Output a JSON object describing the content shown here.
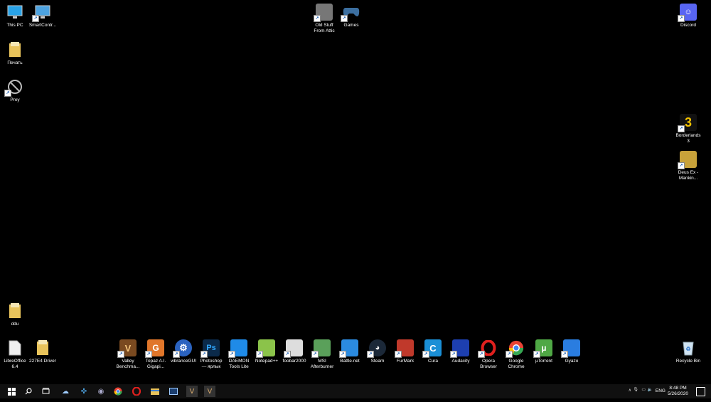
{
  "desktop": {
    "icons": [
      {
        "label": "This PC",
        "icon": "monitor-icon",
        "color": "#29a3e8"
      },
      {
        "label": "SmartContr...",
        "icon": "smartcontrol-icon",
        "color": "#4da3e0"
      },
      {
        "label": "Печать",
        "icon": "folder-icon",
        "color": "#e8c35b"
      },
      {
        "label": "Prey",
        "icon": "prey-icon",
        "color": "#cccccc"
      },
      {
        "label": "Old Stuff\nFrom Attic",
        "icon": "folder-people-icon",
        "color": "#777777"
      },
      {
        "label": "Games",
        "icon": "gamepad-icon",
        "color": "#3c6fa0"
      },
      {
        "label": "Discord",
        "icon": "discord-icon",
        "color": "#5865f2"
      },
      {
        "label": "Borderlands 3",
        "icon": "borderlands-icon",
        "color": "#f2c200"
      },
      {
        "label": "Deus Ex -\nMankin...",
        "icon": "deusex-icon",
        "color": "#c8a23a"
      },
      {
        "label": "ddu",
        "icon": "folder-icon",
        "color": "#e8c35b"
      },
      {
        "label": "LibreOffice\n6.4",
        "icon": "document-icon",
        "color": "#f0f0f0"
      },
      {
        "label": "227E4 Driver",
        "icon": "folder-icon",
        "color": "#e8c35b"
      },
      {
        "label": "Valley\nBenchma...",
        "icon": "valley-icon",
        "color": "#7a4a20"
      },
      {
        "label": "Topaz A.I.\nGigapi...",
        "icon": "topaz-icon",
        "color": "#e0762a"
      },
      {
        "label": "vibranceGUI",
        "icon": "gear-icon",
        "color": "#2b63c0"
      },
      {
        "label": "Photoshop\n— ярлык",
        "icon": "photoshop-icon",
        "color": "#0b2a4a"
      },
      {
        "label": "DAEMON\nTools Lite",
        "icon": "daemon-icon",
        "color": "#1f8be8"
      },
      {
        "label": "Notepad++",
        "icon": "notepad-icon",
        "color": "#8bc34a"
      },
      {
        "label": "foobar2000",
        "icon": "foobar-icon",
        "color": "#dddddd"
      },
      {
        "label": "MSI\nAfterburner",
        "icon": "afterburner-icon",
        "color": "#5aa05a"
      },
      {
        "label": "Battle.net",
        "icon": "battlenet-icon",
        "color": "#2b8be0"
      },
      {
        "label": "Steam",
        "icon": "steam-icon",
        "color": "#1b2838"
      },
      {
        "label": "FurMark",
        "icon": "furmark-icon",
        "color": "#c0392b"
      },
      {
        "label": "Cura",
        "icon": "cura-icon",
        "color": "#1a8fd6"
      },
      {
        "label": "Audacity",
        "icon": "audacity-icon",
        "color": "#1d3fb0"
      },
      {
        "label": "Opera\nBrowser",
        "icon": "opera-icon",
        "color": "#e0201e"
      },
      {
        "label": "Google\nChrome",
        "icon": "chrome-icon",
        "color": "#34a853"
      },
      {
        "label": "µTorrent",
        "icon": "utorrent-icon",
        "color": "#4fa845"
      },
      {
        "label": "Gyazo",
        "icon": "gyazo-icon",
        "color": "#2a7de0"
      },
      {
        "label": "Recycle Bin",
        "icon": "recycle-bin-icon",
        "color": "#cfd8dc"
      }
    ]
  },
  "taskbar": {
    "items": [
      {
        "icon": "start-icon"
      },
      {
        "icon": "search-icon"
      },
      {
        "icon": "task-view-icon"
      },
      {
        "icon": "app-icon-1"
      },
      {
        "icon": "app-icon-2"
      },
      {
        "icon": "steam-icon"
      },
      {
        "icon": "chrome-icon"
      },
      {
        "icon": "opera-icon"
      },
      {
        "icon": "explorer-icon"
      },
      {
        "icon": "window-icon"
      },
      {
        "icon": "valley-icon"
      },
      {
        "icon": "valley-icon-2"
      }
    ],
    "language": "ENG",
    "time": "8:48 PM",
    "date": "5/26/2020"
  }
}
